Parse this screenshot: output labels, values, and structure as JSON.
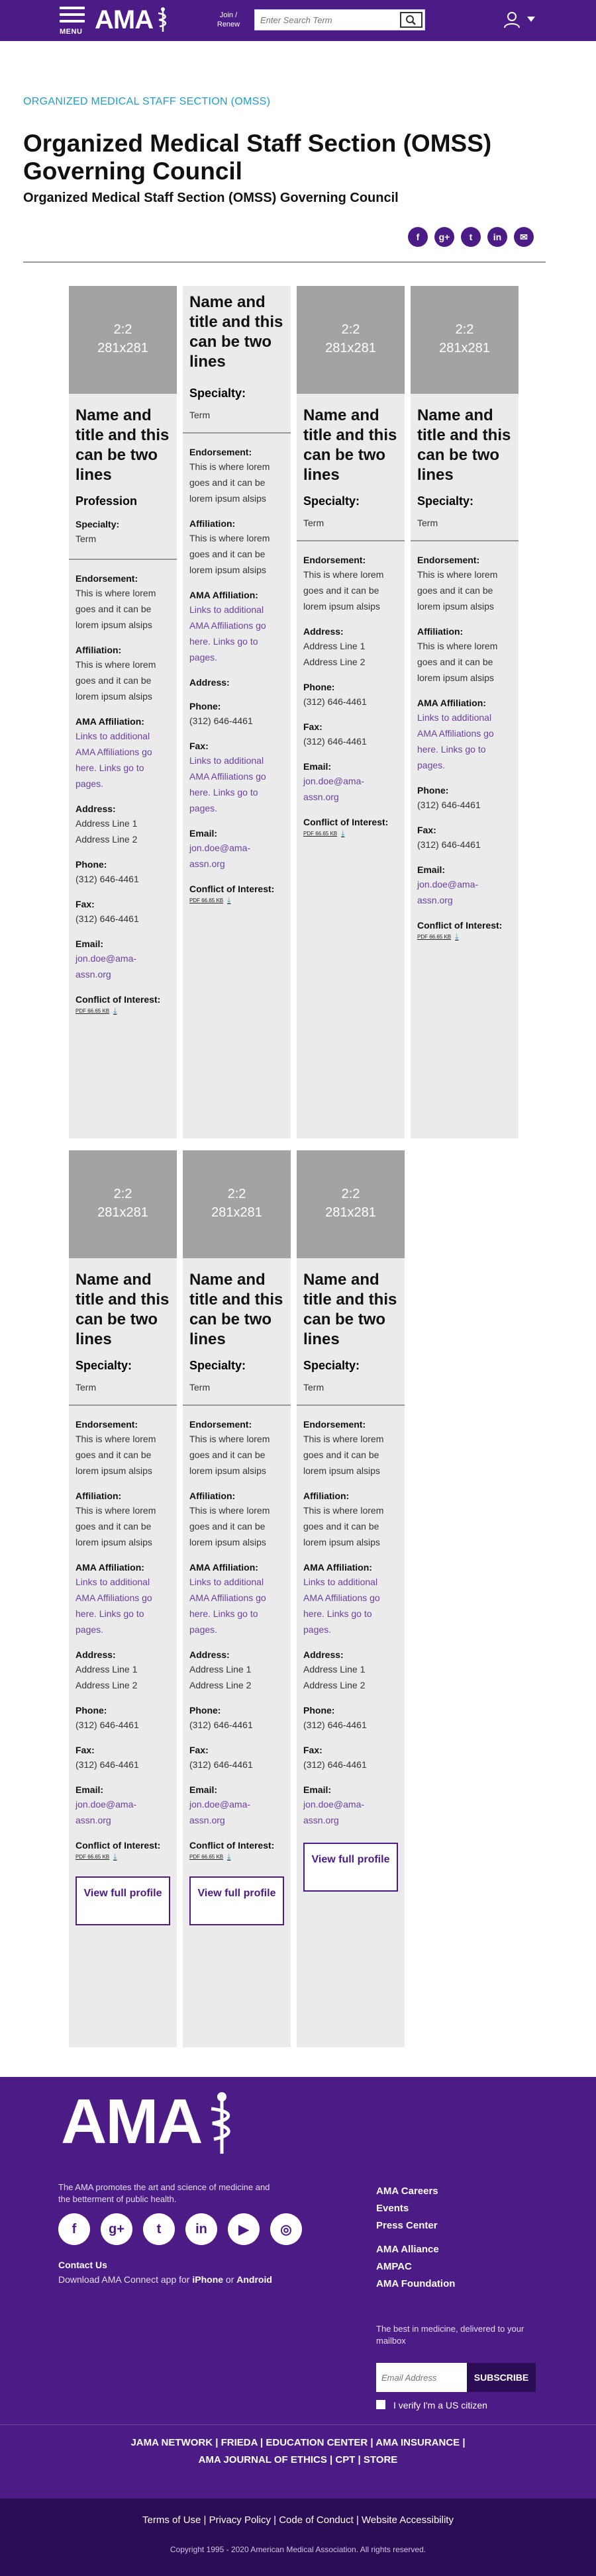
{
  "header": {
    "menu_label": "MENU",
    "logo_text": "AMA",
    "join_label": "Join / Renew",
    "search_placeholder": "Enter Search Term"
  },
  "breadcrumb": "ORGANIZED MEDICAL STAFF SECTION (OMSS)",
  "page_title": "Organized Medical Staff Section (OMSS) Governing Council",
  "page_subtitle": "Organized Medical Staff Section (OMSS) Governing Council",
  "share_icons": [
    "facebook-icon",
    "google-plus-icon",
    "twitter-icon",
    "linkedin-icon",
    "email-icon"
  ],
  "common": {
    "ratio": "2:2",
    "dims": "281x281",
    "name": "Name and title and this can be two lines",
    "profession": "Profession",
    "specialty_label": "Specialty:",
    "specialty_term": "Term",
    "endorsement_label": "Endorsement:",
    "endorsement_text": "This is where lorem goes and it can be lorem ipsum alsips",
    "affiliation_label": "Affiliation:",
    "affiliation_text": "This is where lorem goes and it can be lorem ipsum alsips",
    "ama_affiliation_label": "AMA Affiliation:",
    "ama_affiliation_link": "Links to additional AMA Affiliations go here. Links go to pages.",
    "address_label": "Address:",
    "address_line1": "Address Line 1",
    "address_line2": "Address Line 2",
    "phone_label": "Phone:",
    "phone": "(312) 646-4461",
    "fax_label": "Fax:",
    "fax": "(312) 646-4461",
    "email_label": "Email:",
    "email": "jon.doe@ama-assn.org",
    "conflict_label": "Conflict of Interest:",
    "pdf_label": "PDF 66.65 KB",
    "view_profile": "View full profile"
  },
  "footer": {
    "logo_text": "AMA",
    "description": "The AMA promotes the art and science of medicine and the betterment of public health.",
    "contact": "Contact Us",
    "app_prefix": "Download AMA Connect app for",
    "app_iphone": "iPhone",
    "app_or": "or",
    "app_android": "Android",
    "links_a": [
      "AMA Careers",
      "Events",
      "Press Center"
    ],
    "links_b": [
      "AMA Alliance",
      "AMPAC",
      "AMA Foundation"
    ],
    "newsletter": "The best in medicine, delivered to your mailbox",
    "email_placeholder": "Email Address",
    "subscribe": "SUBSCRIBE",
    "citizen": "I verify I'm a US citizen",
    "bar_row1": "JAMA NETWORK  |  FRIEDA  |  EDUCATION CENTER  |  AMA INSURANCE  |",
    "bar_row2": "AMA JOURNAL OF ETHICS  |  CPT  |  STORE",
    "legal_links": "Terms of Use  |  Privacy Policy  |  Code of Conduct  |  Website Accessibility",
    "copyright": "Copyright 1995 - 2020 American Medical Association. All rights reserved."
  }
}
